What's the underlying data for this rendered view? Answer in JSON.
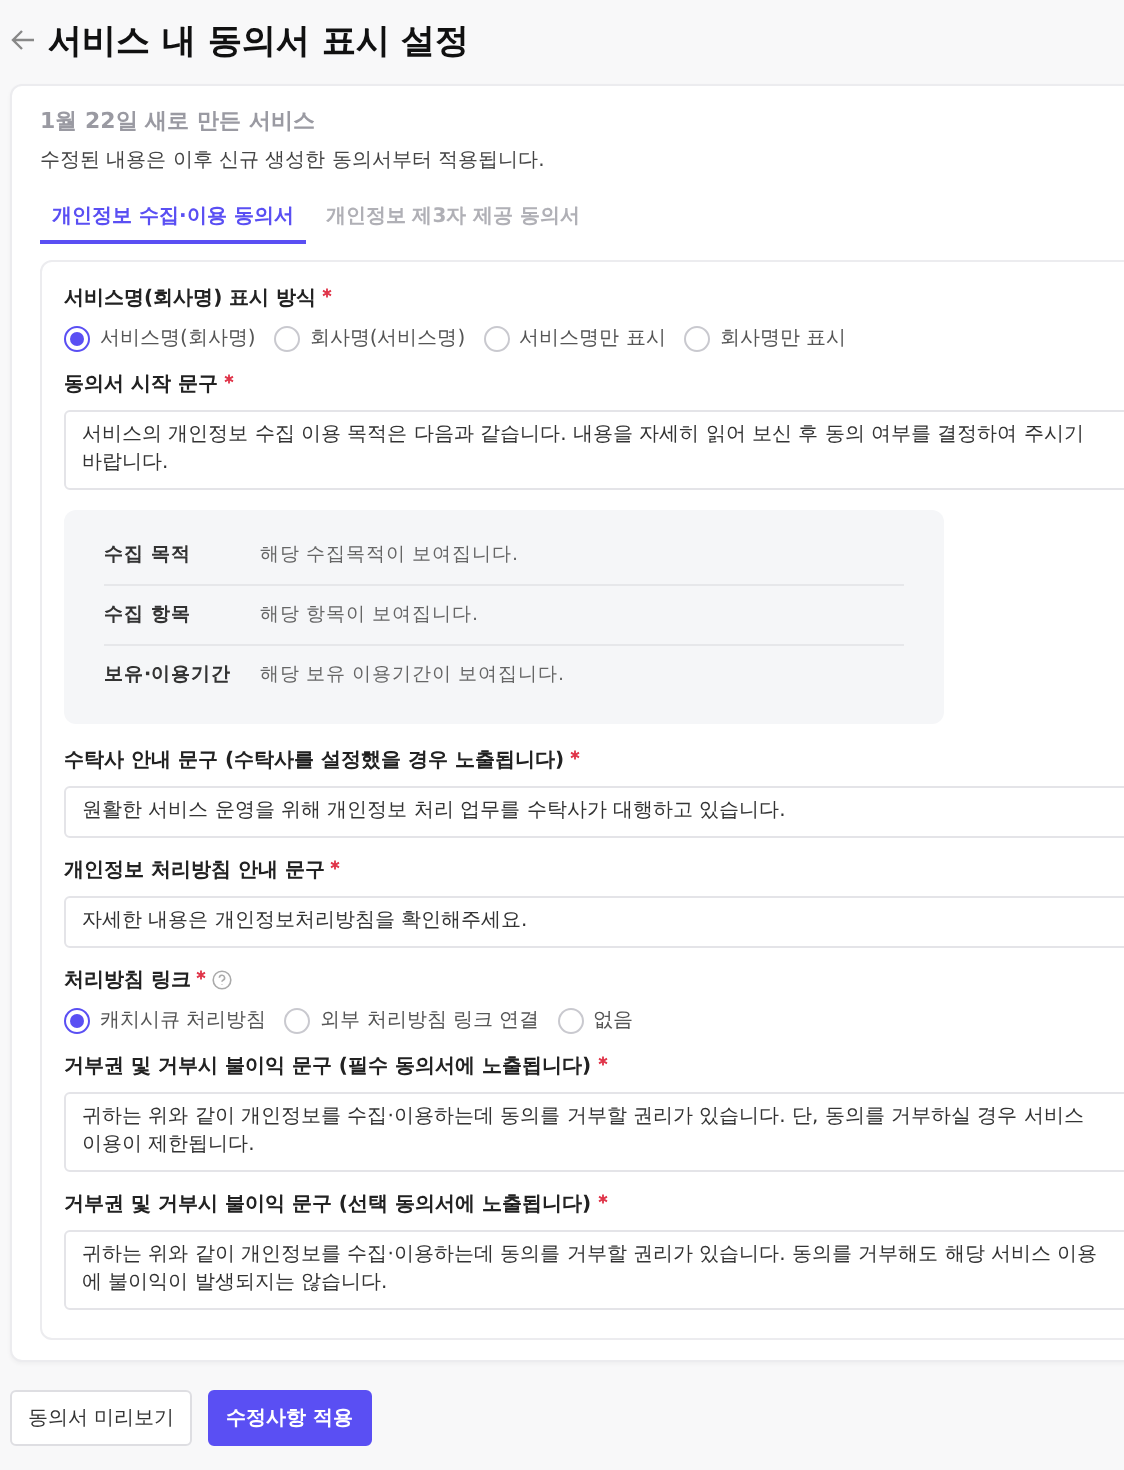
{
  "page": {
    "title": "서비스 내 동의서 표시 설정"
  },
  "service_name": "1월 22일 새로 만든 서비스",
  "notice": "수정된 내용은 이후 신규 생성한 동의서부터 적용됩니다.",
  "tabs": [
    {
      "label": "개인정보 수집·이용 동의서",
      "selected": true
    },
    {
      "label": "개인정보 제3자 제공 동의서",
      "selected": false
    }
  ],
  "fields": [
    {
      "kind": "radio",
      "label": "서비스명(회사명) 표시 방식",
      "required": true,
      "help": false,
      "options": [
        {
          "label": "서비스명(회사명)",
          "selected": true
        },
        {
          "label": "회사명(서비스명)",
          "selected": false
        },
        {
          "label": "서비스명만 표시",
          "selected": false
        },
        {
          "label": "회사명만 표시",
          "selected": false
        }
      ]
    },
    {
      "kind": "text",
      "label": "동의서 시작 문구",
      "required": true,
      "help": false,
      "value": "서비스의 개인정보 수집 이용 목적은 다음과 같습니다. 내용을 자세히 읽어 보신 후 동의 여부를 결정하여 주시기 바랍니다."
    },
    {
      "kind": "summary",
      "rows": [
        {
          "label": "수집 목적",
          "value": "해당 수집목적이 보여집니다."
        },
        {
          "label": "수집 항목",
          "value": "해당 항목이 보여집니다."
        },
        {
          "label": "보유·이용기간",
          "value": "해당 보유 이용기간이 보여집니다."
        }
      ]
    },
    {
      "kind": "text",
      "label": "수탁사 안내 문구 (수탁사를 설정했을 경우 노출됩니다)",
      "required": true,
      "help": false,
      "value": "원활한 서비스 운영을 위해 개인정보 처리 업무를 수탁사가 대행하고 있습니다."
    },
    {
      "kind": "text",
      "label": "개인정보 처리방침 안내 문구",
      "required": true,
      "help": false,
      "value": "자세한 내용은 개인정보처리방침을 확인해주세요."
    },
    {
      "kind": "radio",
      "label": "처리방침 링크",
      "required": true,
      "help": true,
      "options": [
        {
          "label": "캐치시큐 처리방침",
          "selected": true
        },
        {
          "label": "외부 처리방침 링크 연결",
          "selected": false
        },
        {
          "label": "없음",
          "selected": false
        }
      ]
    },
    {
      "kind": "text",
      "label": "거부권 및 거부시 불이익 문구 (필수 동의서에 노출됩니다)",
      "required": true,
      "help": false,
      "value": "귀하는 위와 같이 개인정보를 수집·이용하는데 동의를 거부할 권리가 있습니다. 단, 동의를 거부하실 경우 서비스 이용이 제한됩니다."
    },
    {
      "kind": "text",
      "label": "거부권 및 거부시 불이익 문구 (선택 동의서에 노출됩니다)",
      "required": true,
      "help": false,
      "value": "귀하는 위와 같이 개인정보를 수집·이용하는데 동의를 거부할 권리가 있습니다. 동의를 거부해도 해당 서비스 이용에 불이익이 발생되지는 않습니다."
    }
  ],
  "buttons": [
    {
      "label": "동의서 미리보기",
      "kind": "secondary"
    },
    {
      "label": "수정사항 적용",
      "kind": "primary"
    }
  ]
}
